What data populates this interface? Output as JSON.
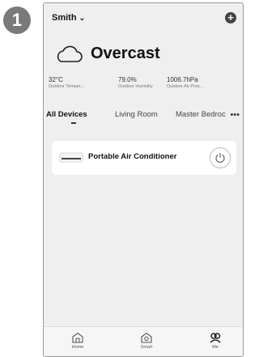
{
  "step_number": "1",
  "header": {
    "home_name": "Smith",
    "chevron": "⌄",
    "add_icon": "+"
  },
  "weather": {
    "condition": "Overcast",
    "icon": "cloud-icon"
  },
  "stats": [
    {
      "value": "32°C",
      "label": "Outdoor Temper..."
    },
    {
      "value": "79.0%",
      "label": "Outdoor Humidity"
    },
    {
      "value": "1006.7hPa",
      "label": "Outdoor Air Pres..."
    }
  ],
  "tabs": [
    {
      "label": "All Devices",
      "active": true
    },
    {
      "label": "Living Room",
      "active": false
    },
    {
      "label": "Master Bedroc",
      "active": false
    }
  ],
  "tabs_more": "•••",
  "devices": [
    {
      "name": "Portable Air Conditioner",
      "icon": "air-conditioner-icon"
    }
  ],
  "nav": [
    {
      "label": "Home",
      "icon": "home-icon"
    },
    {
      "label": "Smart",
      "icon": "smart-icon"
    },
    {
      "label": "Me",
      "icon": "me-icon"
    }
  ]
}
